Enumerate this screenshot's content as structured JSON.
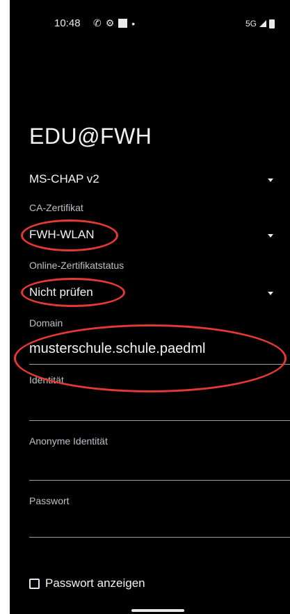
{
  "status_bar": {
    "time": "10:48",
    "network": "5G"
  },
  "title": "EDU@FWH",
  "fields": {
    "phase2": {
      "value": "MS-CHAP v2"
    },
    "ca_cert": {
      "label": "CA-Zertifikat",
      "value": "FWH-WLAN"
    },
    "online_cert_status": {
      "label": "Online-Zertifikatstatus",
      "value": "Nicht prüfen"
    },
    "domain": {
      "label": "Domain",
      "value": "musterschule.schule.paedml"
    },
    "identity": {
      "label": "Identität",
      "value": ""
    },
    "anon_identity": {
      "label": "Anonyme Identität",
      "value": ""
    },
    "password": {
      "label": "Passwort",
      "value": ""
    }
  },
  "show_password": {
    "label": "Passwort anzeigen",
    "checked": false
  },
  "annotation_color": "#e53935",
  "background_color": "#000000",
  "icons": [
    "whatsapp-icon",
    "teams-icon",
    "notification-icon",
    "signal-icon",
    "battery-icon",
    "dropdown-arrow-icon",
    "checkbox-icon"
  ]
}
